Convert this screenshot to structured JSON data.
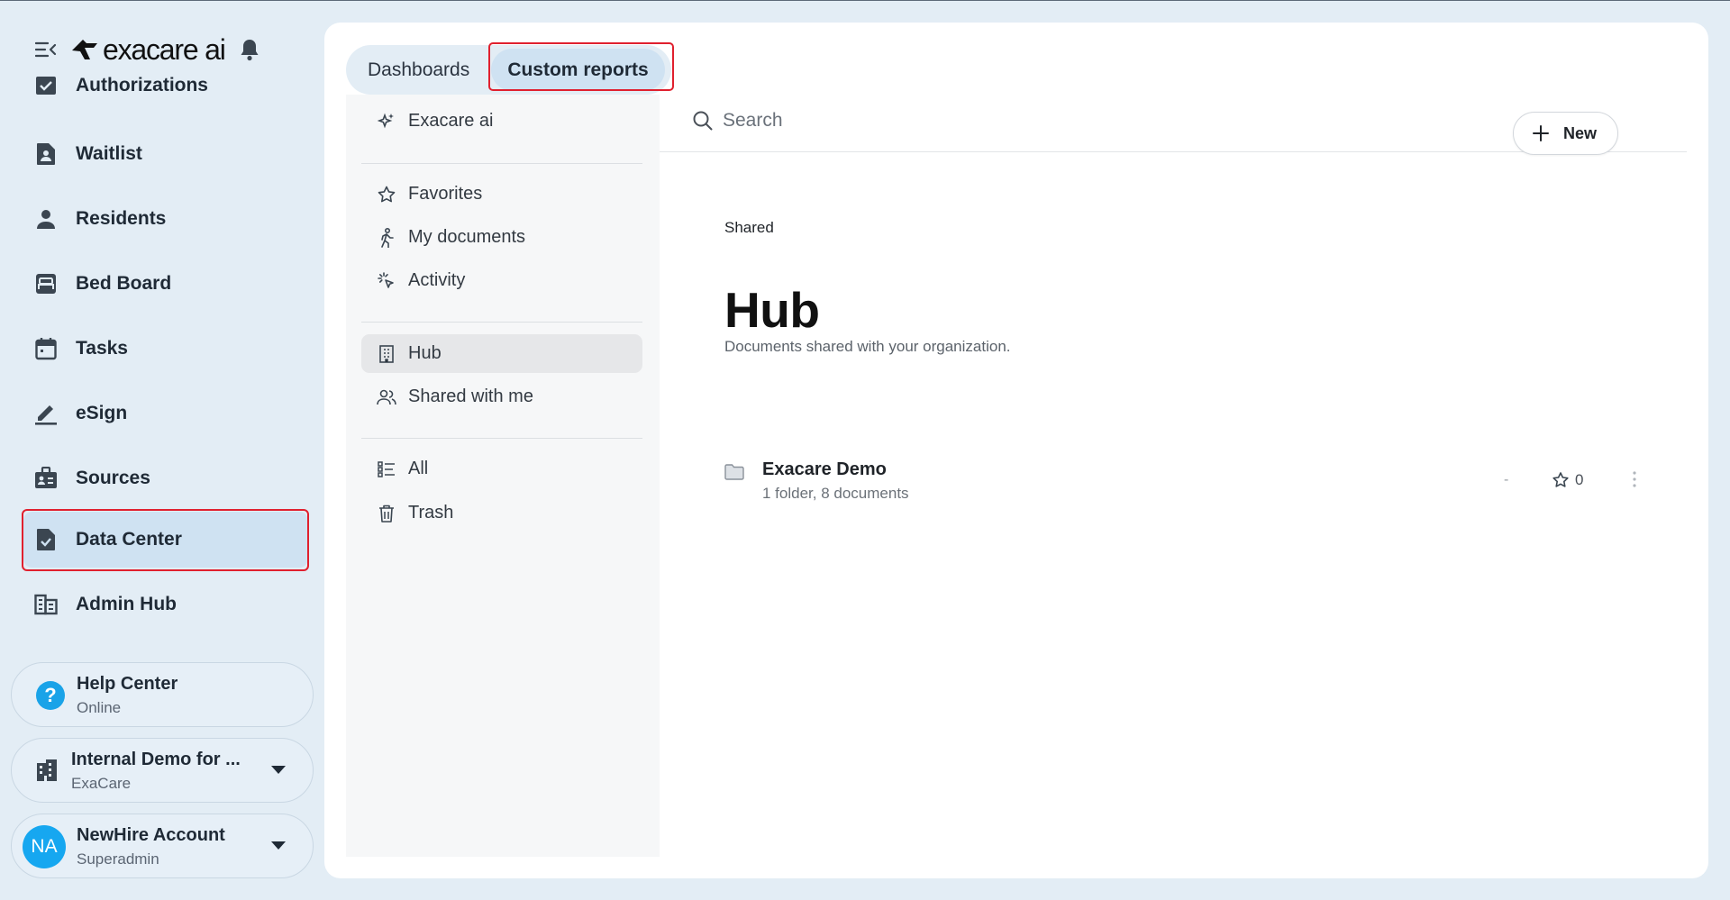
{
  "brand": {
    "name": "exacare ai"
  },
  "sidebar": {
    "items": [
      {
        "label": "Authorizations",
        "icon": "authorizations-icon"
      },
      {
        "label": "Waitlist",
        "icon": "waitlist-icon"
      },
      {
        "label": "Residents",
        "icon": "person-icon"
      },
      {
        "label": "Bed Board",
        "icon": "bed-icon"
      },
      {
        "label": "Tasks",
        "icon": "calendar-icon"
      },
      {
        "label": "eSign",
        "icon": "pen-icon"
      },
      {
        "label": "Sources",
        "icon": "sources-icon"
      },
      {
        "label": "Data Center",
        "icon": "data-center-icon",
        "active": true
      },
      {
        "label": "Admin Hub",
        "icon": "admin-hub-icon"
      }
    ],
    "help": {
      "title": "Help Center",
      "status": "Online"
    },
    "org": {
      "title": "Internal Demo for ...",
      "sub": "ExaCare"
    },
    "user": {
      "initials": "NA",
      "name": "NewHire Account",
      "role": "Superadmin"
    }
  },
  "tabs": {
    "dashboards": "Dashboards",
    "custom_reports": "Custom reports"
  },
  "reports_nav": {
    "exacare_ai": "Exacare ai",
    "favorites": "Favorites",
    "my_documents": "My documents",
    "activity": "Activity",
    "hub": "Hub",
    "shared_with_me": "Shared with me",
    "all": "All",
    "trash": "Trash"
  },
  "search": {
    "placeholder": "Search",
    "value": ""
  },
  "toolbar": {
    "new_label": "New"
  },
  "page": {
    "breadcrumb": "Shared",
    "title": "Hub",
    "subtitle": "Documents shared with your organization."
  },
  "items": [
    {
      "name": "Exacare Demo",
      "meta": "1 folder, 8 documents",
      "modified": "-",
      "stars": "0"
    }
  ],
  "colors": {
    "accent": "#16a7f0",
    "active_bg": "#cfe2f2",
    "highlight_outline": "#e0202e"
  }
}
